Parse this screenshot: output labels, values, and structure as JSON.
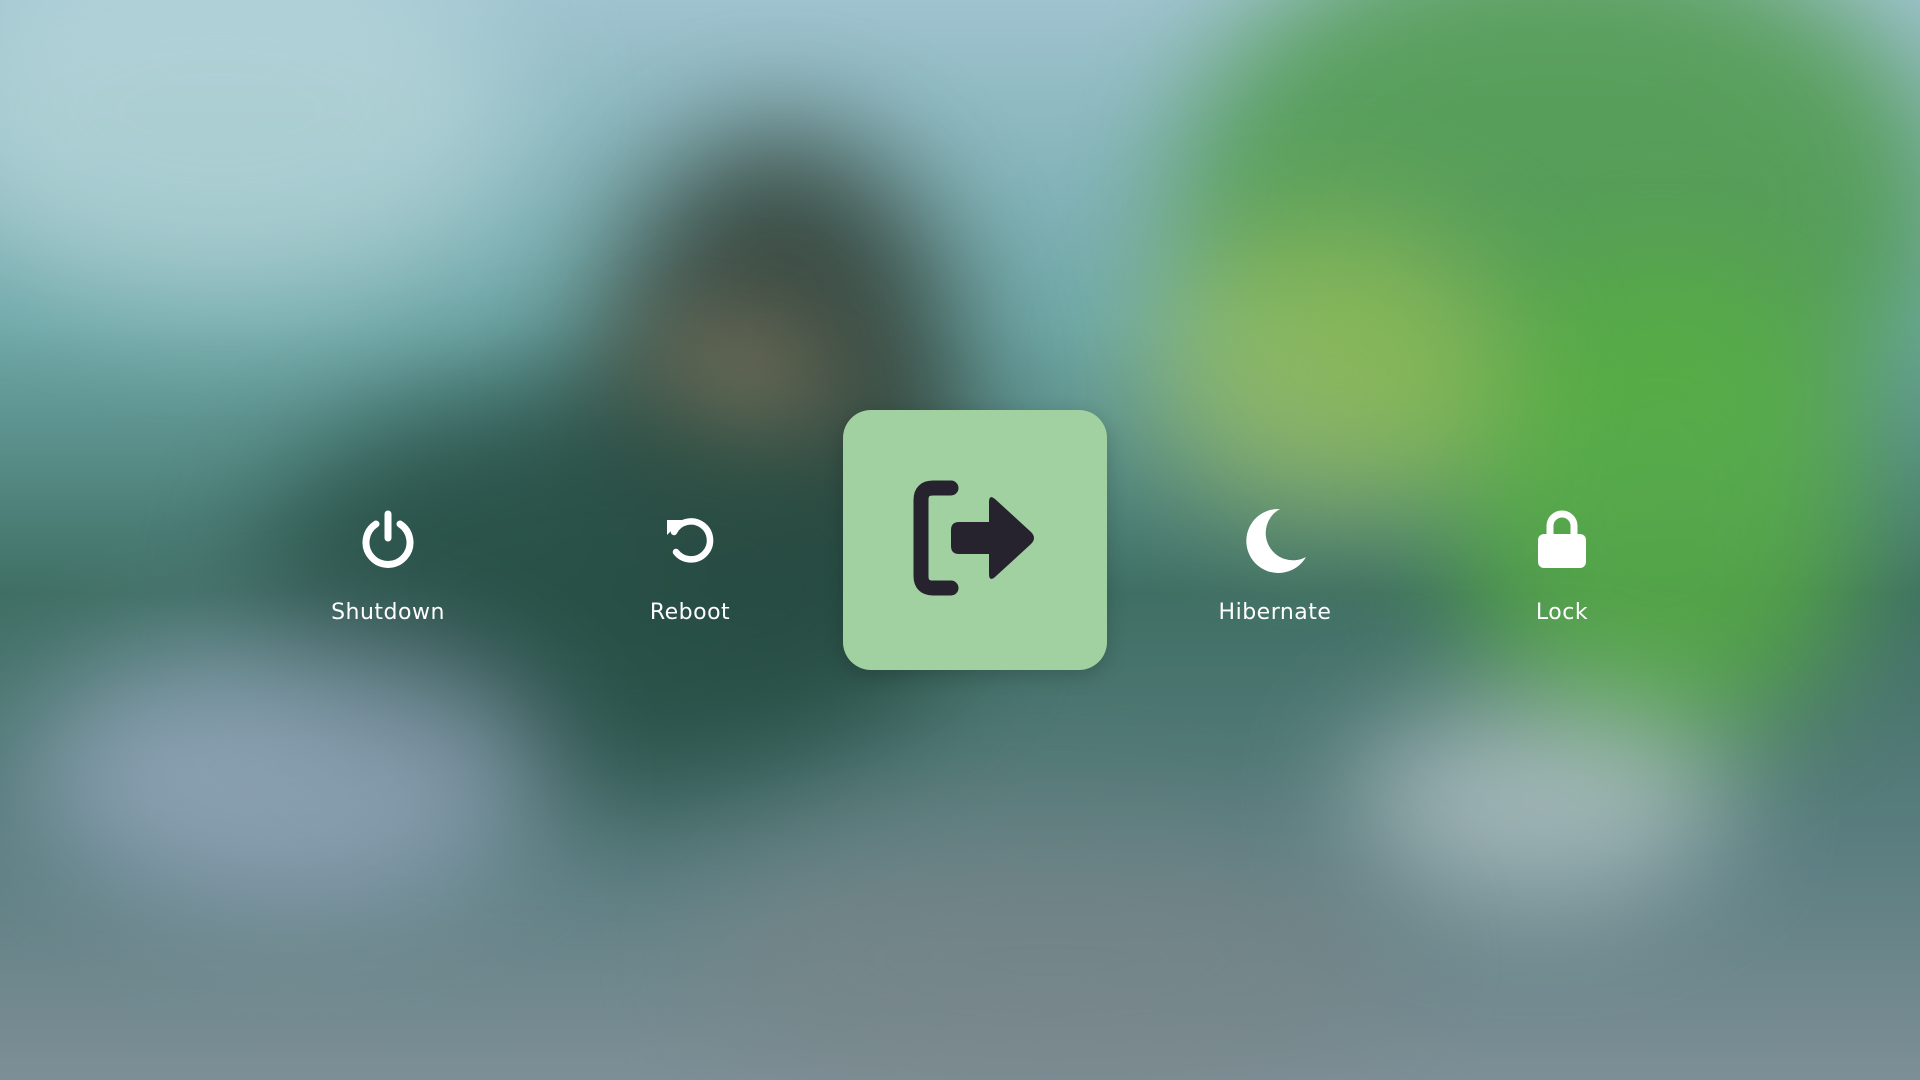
{
  "power_menu": {
    "options": [
      {
        "label": "Shutdown",
        "icon": "power-icon"
      },
      {
        "label": "Reboot",
        "icon": "reboot-icon"
      },
      {
        "label": "Logout",
        "icon": "logout-icon"
      },
      {
        "label": "Hibernate",
        "icon": "moon-icon"
      },
      {
        "label": "Lock",
        "icon": "lock-icon"
      }
    ],
    "selected": "Logout"
  },
  "colors": {
    "selected_tile": "#a1d1a1",
    "selected_icon": "#26232f",
    "label_text": "#ffffff",
    "icon_color": "#ffffff"
  }
}
